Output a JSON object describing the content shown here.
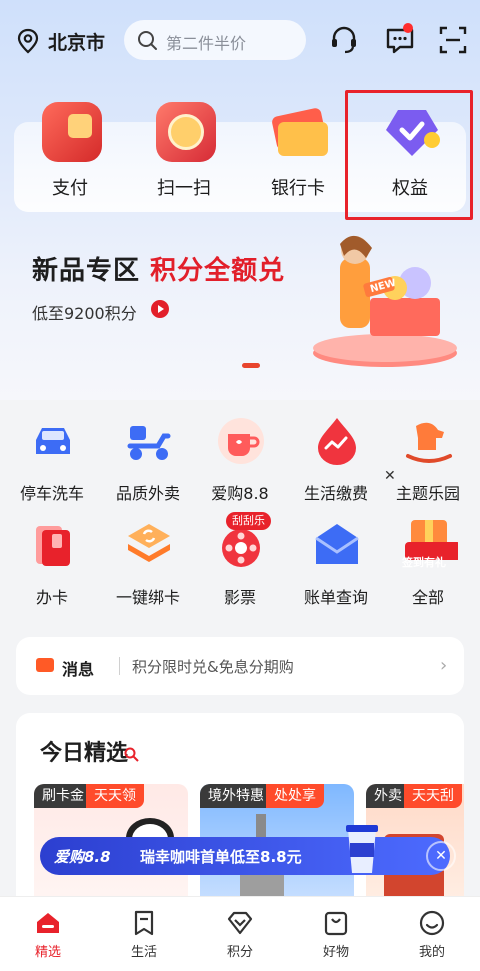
{
  "header": {
    "city": "北京市",
    "search_placeholder": "第二件半价"
  },
  "quick_actions": [
    {
      "label": "支付",
      "icon": "wallet-icon"
    },
    {
      "label": "扫一扫",
      "icon": "scan-icon"
    },
    {
      "label": "银行卡",
      "icon": "bank-card-icon"
    },
    {
      "label": "权益",
      "icon": "benefits-shield-icon"
    }
  ],
  "banner": {
    "title_part1": "新品专区",
    "title_part2": "积分全额兑",
    "subtitle": "低至9200积分",
    "tag": "NEW"
  },
  "services": [
    {
      "label": "停车洗车",
      "icon": "car-icon"
    },
    {
      "label": "品质外卖",
      "icon": "delivery-scooter-icon"
    },
    {
      "label": "爱购8.8",
      "icon": "coffee-cup-icon"
    },
    {
      "label": "生活缴费",
      "icon": "bill-payment-icon"
    },
    {
      "label": "主题乐园",
      "icon": "rocking-horse-icon"
    },
    {
      "label": "办卡",
      "icon": "card-apply-icon"
    },
    {
      "label": "一键绑卡",
      "icon": "link-card-icon"
    },
    {
      "label": "影票",
      "icon": "movie-ticket-icon"
    },
    {
      "label": "账单查询",
      "icon": "bill-envelope-icon"
    },
    {
      "label": "全部",
      "icon": "all-services-icon"
    }
  ],
  "services_extra": {
    "scratch_badge": "刮刮乐",
    "checkin_badge": "签到有礼"
  },
  "message": {
    "title": "消息",
    "text": "积分限时兑&免息分期购"
  },
  "daily": {
    "title": "今日精选",
    "picks": [
      {
        "tag": "刷卡金",
        "tag2": "天天领"
      },
      {
        "tag": "境外特惠",
        "tag2": "处处享"
      },
      {
        "tag": "外卖",
        "tag2": "天天刮"
      }
    ],
    "promo_left": "爱购8.8",
    "promo_right": "瑞幸咖啡首单低至8.8元"
  },
  "tabs": [
    {
      "label": "精选",
      "icon": "home-icon",
      "active": true
    },
    {
      "label": "生活",
      "icon": "bookmark-icon",
      "active": false
    },
    {
      "label": "积分",
      "icon": "diamond-icon",
      "active": false
    },
    {
      "label": "好物",
      "icon": "shopping-bag-icon",
      "active": false
    },
    {
      "label": "我的",
      "icon": "profile-smile-icon",
      "active": false
    }
  ],
  "colors": {
    "accent_red": "#e8222b",
    "header_bg": "#cfe0fb",
    "promo_blue": "#2c3fd0"
  }
}
